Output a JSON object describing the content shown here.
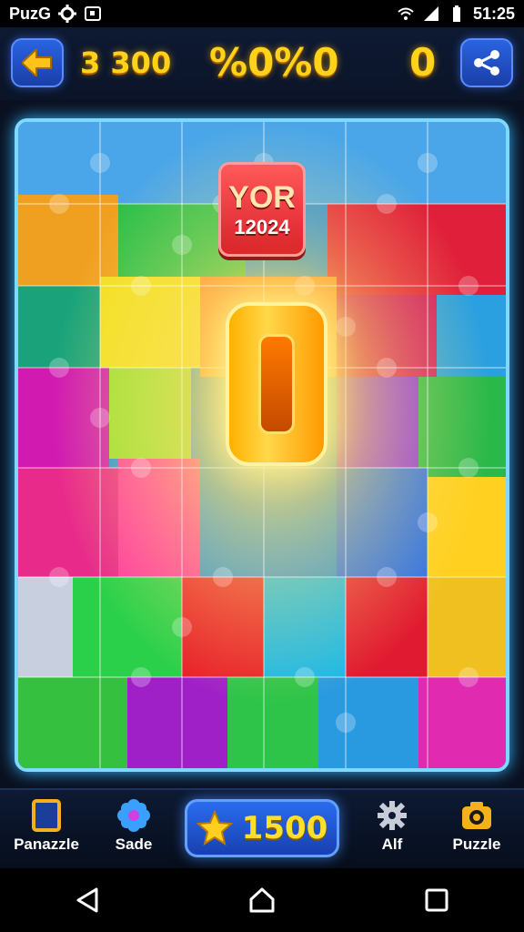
{
  "status_bar": {
    "app_label": "PuzG",
    "time": "51:25"
  },
  "header": {
    "score": "3 300",
    "title": "%0%0",
    "moves": "0"
  },
  "board": {
    "badge_title": "YOR",
    "badge_year": "12024",
    "center_glyph": "0",
    "border_color": "#7fd8ff"
  },
  "toolbar": {
    "pause_label": "Panazzle",
    "shade_label": "Sade",
    "coins": "1500",
    "all_label": "Alf",
    "puzzle_label": "Puzzle"
  },
  "icons": {
    "back": "arrow-left-icon",
    "share": "share-icon",
    "pause": "frame-icon",
    "shade": "flower-icon",
    "coins": "star-icon",
    "all": "gear-icon",
    "puzzle": "camera-icon"
  },
  "colors": {
    "accent": "#2a63e0",
    "gold": "#ffd21a",
    "board_glow": "#36b6ff"
  }
}
